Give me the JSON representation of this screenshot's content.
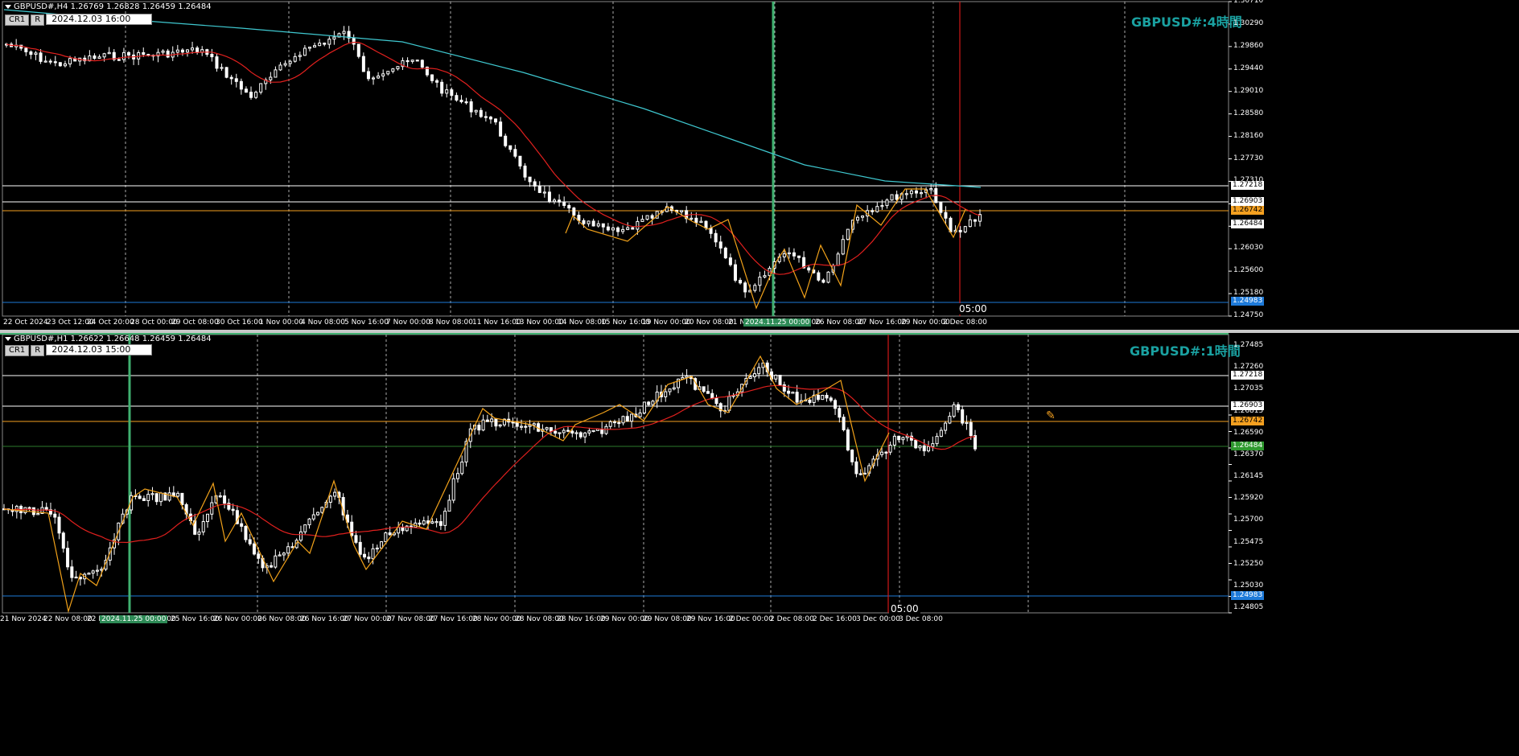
{
  "colors": {
    "bg": "#000000",
    "grid": "#c8c8c8",
    "ma_fast": "#e0201e",
    "ma_slow": "#3fc8d0",
    "zigzag": "#f2a21a",
    "hline_white": "#ffffff",
    "hline_orange": "#f4a020",
    "hline_blue": "#1e7ad9",
    "hline_green": "#2b7d2b",
    "vline_green": "#40b070",
    "vline_red": "#d01818",
    "tag_blue": "#1e7ad9",
    "tag_orange": "#f4a020",
    "tag_green": "#2f9a2f",
    "wm": "#1aa1a1"
  },
  "top": {
    "header": "GBPUSD#,H4  1.26769 1.26828 1.26459 1.26484",
    "cr_label": "CR1",
    "r_label": "R",
    "time_box": "2024.12.03 16:00",
    "watermark": "GBPUSD#:4時間",
    "y_labels": [
      "1.30710",
      "1.30290",
      "1.29860",
      "1.29440",
      "1.29010",
      "1.28580",
      "1.28160",
      "1.27730",
      "1.27310",
      "1.26880",
      "1.26460",
      "1.26030",
      "1.25600",
      "1.25180",
      "1.24750"
    ],
    "price_tags": [
      {
        "label": "1.27218",
        "kind": "white"
      },
      {
        "label": "1.26903",
        "kind": "white"
      },
      {
        "label": "1.26742",
        "kind": "orange"
      },
      {
        "label": "1.26484",
        "kind": "white"
      },
      {
        "label": "1.24983",
        "kind": "blue"
      }
    ],
    "x_labels": [
      "22 Oct 2024",
      "23 Oct 12:00",
      "24 Oct 20:00",
      "28 Oct 00:00",
      "29 Oct 08:00",
      "30 Oct 16:00",
      "1 Nov 00:00",
      "4 Nov 08:00",
      "5 Nov 16:00",
      "7 Nov 00:00",
      "8 Nov 08:00",
      "11 Nov 16:00",
      "13 Nov 00:00",
      "14 Nov 08:00",
      "15 Nov 16:00",
      "19 Nov 00:00",
      "20 Nov 08:00",
      "21 No"
    ],
    "x_labels_b": [
      "00:00",
      "26 Nov 08:00",
      "27 Nov 16:00",
      "29 Nov 00:00",
      "2 Dec 08:00"
    ],
    "highlight_x": "2024.11.25 00:00",
    "vline_time": "05:00"
  },
  "bottom": {
    "header": "GBPUSD#,H1  1.26622 1.26648 1.26459 1.26484",
    "cr_label": "CR1",
    "r_label": "R",
    "time_box": "2024.12.03 15:00",
    "watermark": "GBPUSD#:1時間",
    "y_labels": [
      "1.27485",
      "1.27260",
      "1.27035",
      "1.26815",
      "1.26590",
      "1.26370",
      "1.26145",
      "1.25920",
      "1.25700",
      "1.25475",
      "1.25250",
      "1.25030",
      "1.24805"
    ],
    "price_tags": [
      {
        "label": "1.27218",
        "kind": "white"
      },
      {
        "label": "1.26903",
        "kind": "white"
      },
      {
        "label": "1.26742",
        "kind": "orange"
      },
      {
        "label": "1.26484",
        "kind": "green"
      },
      {
        "label": "1.24983",
        "kind": "blue"
      }
    ],
    "x_labels": [
      "21 Nov 2024",
      "22 Nov 08:00",
      "22 No",
      "25 Nov 08:00",
      "25 Nov 16:00",
      "26 Nov 00:00",
      "26 Nov 08:00",
      "26 Nov 16:00",
      "27 Nov 00:00",
      "27 Nov 08:00",
      "27 Nov 16:00",
      "28 Nov 00:00",
      "28 Nov 08:00",
      "28 Nov 16:00",
      "29 Nov 00:00",
      "29 Nov 08:00",
      "29 Nov 16:00",
      "2 Dec 00:00",
      "2 Dec 08:00",
      "2 Dec 16:00",
      "3 Dec 00:00",
      "3 Dec 08:00"
    ],
    "highlight_x": "2024.11.25 00:00",
    "vline_time": "05:00"
  }
}
